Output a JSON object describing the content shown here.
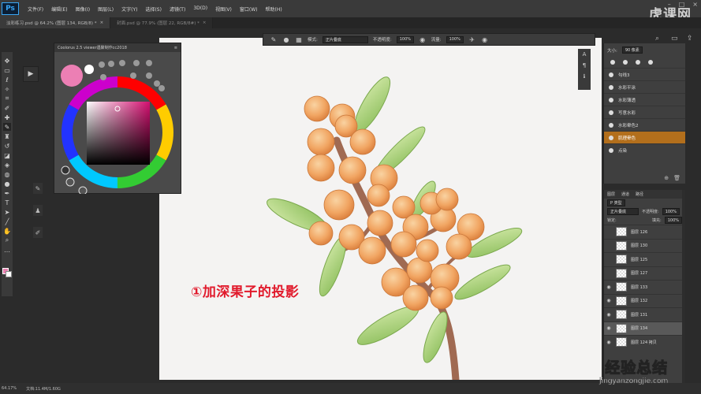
{
  "app": {
    "logo": "Ps",
    "brand": "虎课网"
  },
  "menu": [
    "文件(F)",
    "编辑(E)",
    "图像(I)",
    "图层(L)",
    "文字(Y)",
    "选择(S)",
    "滤镜(T)",
    "3D(D)",
    "视图(V)",
    "窗口(W)",
    "帮助(H)"
  ],
  "tabs": [
    {
      "label": "淡彩练习.psd @ 64.2% (图层 134, RGB/8) *",
      "active": true
    },
    {
      "label": "封面.psd @ 77.9% (图层 22, RGB/8#) *",
      "active": false
    }
  ],
  "options": {
    "mode_label": "模式:",
    "mode_value": "正片叠底",
    "opacity_label": "不透明度:",
    "opacity_value": "100%",
    "flow_label": "流量:",
    "flow_value": "100%"
  },
  "coolorus": {
    "title": "Coolorus 2.5 viewer遇聚制作cc2018",
    "fg_color": "#ec7fb4",
    "bg_color": "#ffffff"
  },
  "brushes": {
    "size_label": "大小:",
    "size_value": "90 像素",
    "items": [
      {
        "label": "勾线3",
        "selected": false
      },
      {
        "label": "水彩平涂",
        "selected": false
      },
      {
        "label": "水彩薄透",
        "selected": false
      },
      {
        "label": "写意水彩",
        "selected": false
      },
      {
        "label": "水彩晕色2",
        "selected": false
      },
      {
        "label": "肌理晕色",
        "selected": true
      },
      {
        "label": "点染",
        "selected": false
      }
    ]
  },
  "layers": {
    "tabs": [
      "图层",
      "通道",
      "路径"
    ],
    "filter_label": "P 类型",
    "blend_mode": "正片叠底",
    "opacity_label": "不透明度:",
    "opacity_value": "100%",
    "fill_label": "填充:",
    "fill_value": "100%",
    "items": [
      {
        "name": "图层 126",
        "visible": false,
        "selected": false
      },
      {
        "name": "图层 130",
        "visible": false,
        "selected": false
      },
      {
        "name": "图层 125",
        "visible": false,
        "selected": false
      },
      {
        "name": "图层 127",
        "visible": false,
        "selected": false
      },
      {
        "name": "图层 133",
        "visible": true,
        "selected": false
      },
      {
        "name": "图层 132",
        "visible": true,
        "selected": false
      },
      {
        "name": "图层 131",
        "visible": true,
        "selected": false
      },
      {
        "name": "图层 134",
        "visible": true,
        "selected": true
      },
      {
        "name": "图层 124 拷贝",
        "visible": true,
        "selected": false
      }
    ]
  },
  "status": {
    "zoom": "64.17%",
    "doc": "文档:11.4M/1.60G"
  },
  "annotation": "①加深果子的投影",
  "watermark": {
    "big": "经验总结",
    "small": "jingyanzongjie.com"
  }
}
